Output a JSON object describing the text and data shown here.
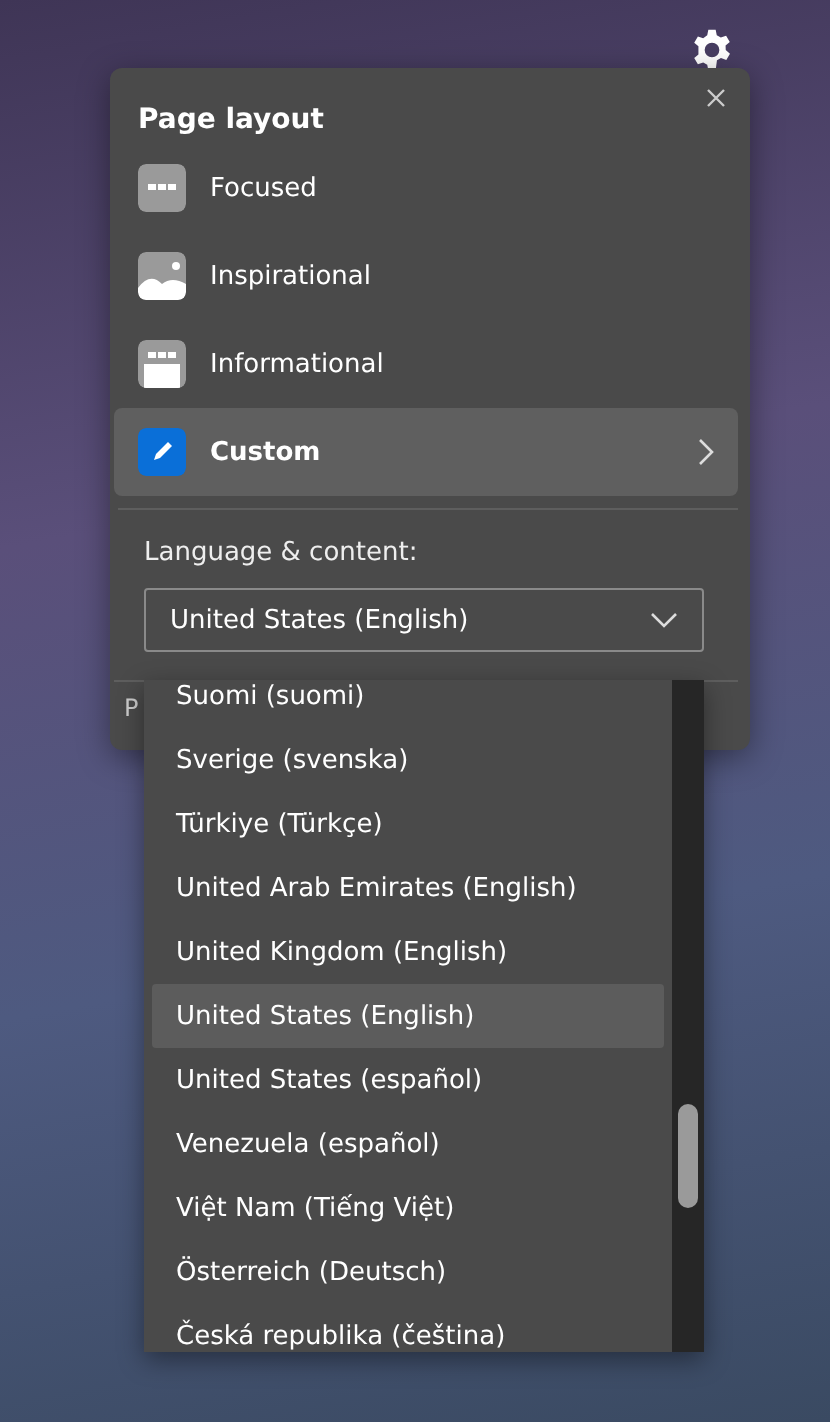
{
  "panel": {
    "title": "Page layout",
    "layouts": [
      {
        "label": "Focused",
        "kind": "focused",
        "selected": false
      },
      {
        "label": "Inspirational",
        "kind": "inspirational",
        "selected": false
      },
      {
        "label": "Informational",
        "kind": "informational",
        "selected": false
      },
      {
        "label": "Custom",
        "kind": "custom",
        "selected": true
      }
    ],
    "language_label": "Language & content:",
    "language_select": {
      "value": "United States (English)",
      "expanded": true
    },
    "footer_text": "P"
  },
  "dropdown": {
    "options": [
      {
        "label": "Suomi (suomi)",
        "selected": false
      },
      {
        "label": "Sverige (svenska)",
        "selected": false
      },
      {
        "label": "Türkiye (Türkçe)",
        "selected": false
      },
      {
        "label": "United Arab Emirates (English)",
        "selected": false
      },
      {
        "label": "United Kingdom (English)",
        "selected": false
      },
      {
        "label": "United States (English)",
        "selected": true
      },
      {
        "label": "United States (español)",
        "selected": false
      },
      {
        "label": "Venezuela (español)",
        "selected": false
      },
      {
        "label": "Việt Nam (Tiếng Việt)",
        "selected": false
      },
      {
        "label": "Österreich (Deutsch)",
        "selected": false
      },
      {
        "label": "Česká republika (čeština)",
        "selected": false
      }
    ]
  }
}
